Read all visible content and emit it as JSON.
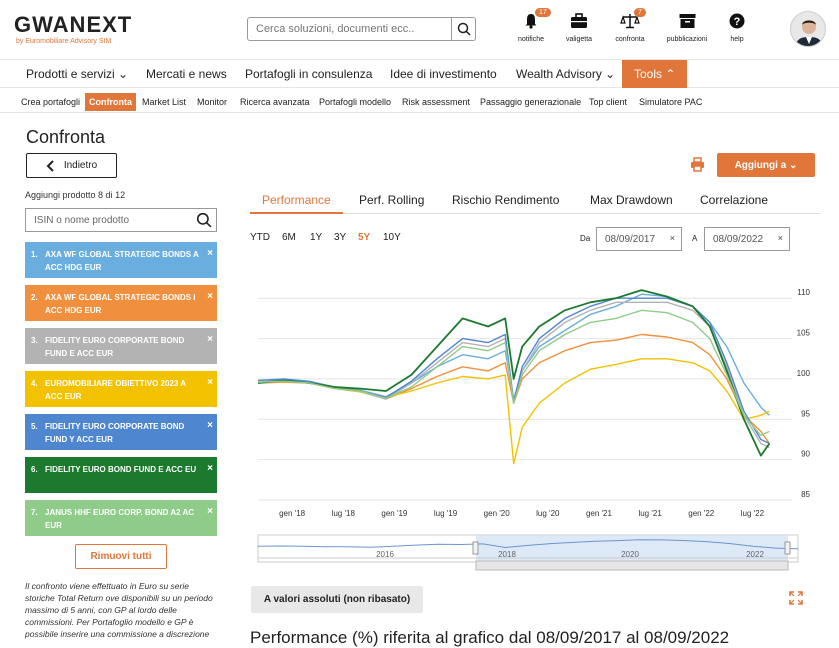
{
  "header": {
    "logo": "GWANEXT",
    "logo_sub": "by Euromobiliare Advisory SIM",
    "search_placeholder": "Cerca soluzioni, documenti ecc..",
    "icons": [
      {
        "name": "bell-icon",
        "label": "notifiche",
        "badge": "17"
      },
      {
        "name": "briefcase-icon",
        "label": "valigetta",
        "badge": ""
      },
      {
        "name": "scale-icon",
        "label": "confronta",
        "badge": "7"
      },
      {
        "name": "archive-icon",
        "label": "pubblicazioni",
        "badge": ""
      },
      {
        "name": "help-icon",
        "label": "help",
        "badge": ""
      }
    ]
  },
  "nav": {
    "main": [
      "Prodotti e servizi",
      "Mercati e news",
      "Portafogli in consulenza",
      "Idee di investimento",
      "Wealth Advisory",
      "Tools"
    ],
    "sub": [
      "Crea portafogli",
      "Confronta",
      "Market List",
      "Monitor",
      "Ricerca avanzata",
      "Portafogli modello",
      "Risk assessment",
      "Passaggio generazionale",
      "Top client",
      "Simulatore PAC"
    ]
  },
  "page": {
    "title": "Confronta",
    "back_label": "Indietro",
    "add_label": "Aggiungi a",
    "add_count": "Aggiungi prodotto 8 di 12",
    "isin_placeholder": "ISIN o nome prodotto",
    "remove_all": "Rimuovi tutti",
    "note": "Il confronto viene effettuato in Euro su serie storiche Total Return ove disponibili su un periodo massimo di 5 anni, con GP al lordo delle commissioni. Per Portafoglio modello e GP è possibile inserire una commissione a discrezione",
    "abs_values_btn": "A valori assoluti (non ribasato)",
    "perf_heading": "Performance (%) riferita al grafico dal 08/09/2017 al 08/09/2022"
  },
  "products": [
    {
      "num": "1.",
      "name": "AXA WF GLOBAL STRATEGIC BONDS A ACC HDG EUR",
      "color": "#6aaee0"
    },
    {
      "num": "2.",
      "name": "AXA WF GLOBAL STRATEGIC BONDS I ACC HDG EUR",
      "color": "#f0903e"
    },
    {
      "num": "3.",
      "name": "FIDELITY EURO CORPORATE BOND FUND E ACC EUR",
      "color": "#b3b3b3"
    },
    {
      "num": "4.",
      "name": "EUROMOBILIARE OBIETTIVO 2023 A ACC EUR",
      "color": "#f2c200"
    },
    {
      "num": "5.",
      "name": "FIDELITY EURO CORPORATE BOND FUND Y ACC EUR",
      "color": "#4f86d0"
    },
    {
      "num": "6.",
      "name": "FIDELITY EURO BOND FUND E ACC EU",
      "color": "#1c7a2e"
    },
    {
      "num": "7.",
      "name": "JANUS HHF EURO CORP. BOND A2 AC EUR",
      "color": "#8fcc8a"
    }
  ],
  "tabs": [
    "Performance",
    "Perf. Rolling",
    "Rischio Rendimento",
    "Max Drawdown",
    "Correlazione"
  ],
  "periods": [
    "YTD",
    "6M",
    "1Y",
    "3Y",
    "5Y",
    "10Y"
  ],
  "dates": {
    "from_label": "Da",
    "from": "08/09/2017",
    "to_label": "A",
    "to": "08/09/2022"
  },
  "chart_data": {
    "type": "line",
    "x_ticks": [
      "gen '18",
      "lug '18",
      "gen '19",
      "lug '19",
      "gen '20",
      "lug '20",
      "gen '21",
      "lug '21",
      "gen '22",
      "lug '22"
    ],
    "y_ticks": [
      85,
      90,
      95,
      100,
      105,
      110
    ],
    "ylim": [
      85,
      113
    ],
    "navigator_ticks": [
      "2016",
      "2018",
      "2020",
      "2022"
    ],
    "x": [
      "2017-09",
      "2017-12",
      "2018-03",
      "2018-06",
      "2018-09",
      "2018-12",
      "2019-03",
      "2019-06",
      "2019-09",
      "2019-12",
      "2020-02",
      "2020-03",
      "2020-04",
      "2020-06",
      "2020-09",
      "2020-12",
      "2021-03",
      "2021-06",
      "2021-09",
      "2021-12",
      "2022-02",
      "2022-04",
      "2022-06",
      "2022-08",
      "2022-09"
    ],
    "series": [
      {
        "color": "#6aaee0",
        "values": [
          99.5,
          100,
          99.6,
          98.9,
          98.6,
          97.8,
          99.5,
          101.5,
          103,
          102.5,
          103.5,
          97.5,
          101,
          104,
          106,
          108,
          109,
          110.5,
          110.2,
          109,
          107,
          104,
          99.5,
          96.5,
          95.5
        ]
      },
      {
        "color": "#f0903e",
        "values": [
          99.5,
          99.6,
          99.5,
          99,
          98.5,
          97.5,
          98.8,
          100.3,
          101.5,
          101,
          102,
          97,
          100,
          102,
          103.5,
          104.5,
          104.8,
          105.5,
          105.2,
          104.5,
          103,
          100,
          95.5,
          93.5,
          92
        ]
      },
      {
        "color": "#b3b3b3",
        "values": [
          99.6,
          99.8,
          99.5,
          98.8,
          98.4,
          97.5,
          99.5,
          102,
          104.5,
          104,
          105,
          97,
          101,
          104.5,
          107,
          108.5,
          109.5,
          109.5,
          109.5,
          108.5,
          106.5,
          101.5,
          95.5,
          92,
          91.5
        ]
      },
      {
        "color": "#f2c200",
        "values": [
          99.6,
          99.7,
          99.5,
          98.8,
          98.4,
          97.7,
          98.5,
          99.5,
          100.3,
          100,
          100.5,
          89.5,
          94,
          97,
          99.5,
          101.2,
          101.8,
          102.5,
          102.5,
          102,
          101,
          98.5,
          95,
          95.5,
          96
        ]
      },
      {
        "color": "#4f86d0",
        "values": [
          99.8,
          100,
          99.7,
          99,
          98.5,
          97.7,
          99.7,
          102.5,
          105,
          104.5,
          105.5,
          97.2,
          101.5,
          105,
          107.5,
          109,
          110,
          110,
          110,
          109,
          107,
          102,
          96,
          92.5,
          92
        ]
      },
      {
        "color": "#1c7a2e",
        "values": [
          99.5,
          99.8,
          99.5,
          99,
          98.8,
          98.5,
          100.5,
          104,
          107.5,
          106.5,
          107.5,
          100,
          104,
          106.5,
          108.5,
          109.5,
          110,
          111,
          110.2,
          109,
          106.5,
          101,
          95,
          90.5,
          92
        ]
      },
      {
        "color": "#8fcc8a",
        "values": [
          99.6,
          99.7,
          99.5,
          98.8,
          98.5,
          97.6,
          99,
          101.5,
          104,
          103.5,
          104.5,
          97,
          100.5,
          103.5,
          105.5,
          107,
          107.5,
          108.5,
          108.2,
          107,
          105,
          100.5,
          95.5,
          93,
          93.5
        ]
      }
    ]
  }
}
